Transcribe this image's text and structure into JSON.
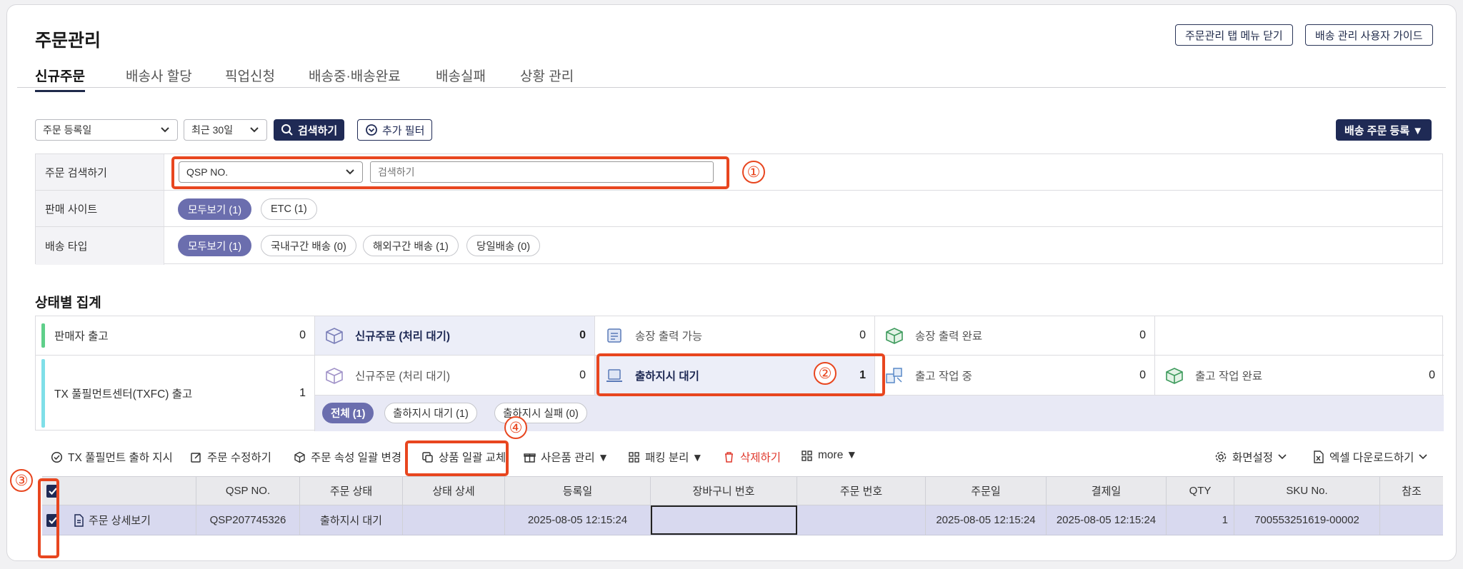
{
  "page": {
    "title": "주문관리",
    "top_buttons": [
      "주문관리 탭 메뉴 닫기",
      "배송 관리 사용자 가이드"
    ]
  },
  "tabs": [
    {
      "label": "신규주문",
      "active": true
    },
    {
      "label": "배송사 할당",
      "active": false
    },
    {
      "label": "픽업신청",
      "active": false
    },
    {
      "label": "배송중·배송완료",
      "active": false
    },
    {
      "label": "배송실패",
      "active": false
    },
    {
      "label": "상황 관리",
      "active": false
    }
  ],
  "search_bar": {
    "date_type": "주문 등록일",
    "period": "최근 30일",
    "search_button": "검색하기",
    "filter_button": "추가 필터",
    "register_button": "배송 주문 등록 ▼"
  },
  "filters": {
    "order_search": {
      "label": "주문 검색하기",
      "select_value": "QSP NO.",
      "placeholder": "검색하기"
    },
    "sales_site": {
      "label": "판매 사이트",
      "options": [
        "모두보기 (1)",
        "ETC (1)"
      ]
    },
    "delivery_type": {
      "label": "배송 타입",
      "options": [
        "모두보기 (1)",
        "국내구간 배송 (0)",
        "해외구간 배송 (1)",
        "당일배송 (0)"
      ]
    }
  },
  "status_summary": {
    "title": "상태별 집계",
    "seller": {
      "label": "판매자 출고",
      "count": "0",
      "accent": "#5fcf8a"
    },
    "txfc": {
      "label": "TX 풀필먼트센터(TXFC) 출고",
      "count": "1",
      "accent": "#7fdfe8"
    },
    "row1": [
      {
        "label": "신규주문 (처리 대기)",
        "count": "0",
        "icon": "box-icon"
      },
      {
        "label": "송장 출력 가능",
        "count": "0",
        "icon": "printer-icon"
      },
      {
        "label": "송장 출력 완료",
        "count": "0",
        "icon": "box-check-icon"
      }
    ],
    "row2": [
      {
        "label": "신규주문 (처리 대기)",
        "count": "0",
        "icon": "box-icon"
      },
      {
        "label": "출하지시 대기",
        "count": "1",
        "icon": "laptop-icon"
      },
      {
        "label": "출고 작업 중",
        "count": "0",
        "icon": "boxes-icon"
      },
      {
        "label": "출고 작업 완료",
        "count": "0",
        "icon": "box-check-icon"
      }
    ],
    "sub_filters": [
      "전체 (1)",
      "출하지시 대기 (1)",
      "출하지시 실패 (0)"
    ]
  },
  "toolbar": {
    "actions": [
      "TX 풀필먼트 출하 지시",
      "주문 수정하기",
      "주문 속성 일괄 변경",
      "상품 일괄 교체",
      "사은품 관리 ▼",
      "패킹 분리 ▼",
      "삭제하기",
      "more ▼"
    ],
    "right": [
      "화면설정",
      "엑셀 다운로드하기"
    ]
  },
  "table": {
    "columns": [
      "",
      "QSP NO.",
      "주문 상태",
      "상태 상세",
      "등록일",
      "장바구니 번호",
      "주문 번호",
      "주문일",
      "결제일",
      "QTY",
      "SKU No.",
      "참조"
    ],
    "rows": [
      {
        "detail": "주문 상세보기",
        "qsp_no": "QSP207745326",
        "status": "출하지시 대기",
        "status_detail": "",
        "reg_date": "2025-08-05 12:15:24",
        "cart_no": "",
        "order_no": "",
        "order_date": "2025-08-05 12:15:24",
        "pay_date": "2025-08-05 12:15:24",
        "qty": "1",
        "sku": "700553251619-00002"
      }
    ]
  },
  "annotations": [
    "①",
    "②",
    "③",
    "④"
  ],
  "colors": {
    "navy": "#1f2a55",
    "pill_active": "#6b6eae",
    "highlight": "#e8461f",
    "selected_row": "#d8d9ef"
  }
}
